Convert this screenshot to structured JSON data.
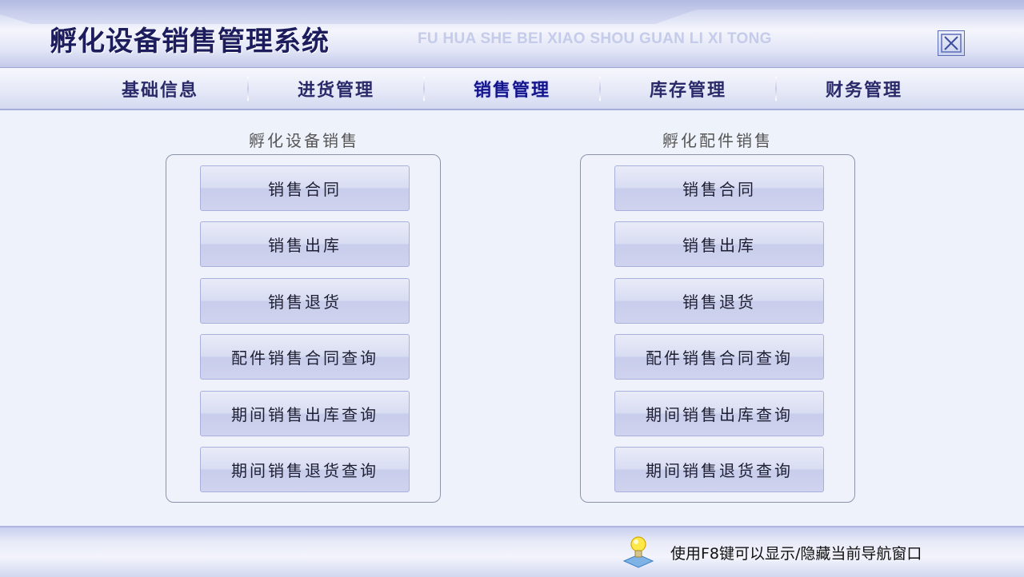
{
  "app": {
    "title": "孵化设备销售管理系统",
    "subtitle": "FU HUA SHE BEI XIAO SHOU GUAN LI XI TONG"
  },
  "nav": {
    "items": [
      {
        "label": "基础信息",
        "active": false
      },
      {
        "label": "进货管理",
        "active": false
      },
      {
        "label": "销售管理",
        "active": true
      },
      {
        "label": "库存管理",
        "active": false
      },
      {
        "label": "财务管理",
        "active": false
      }
    ]
  },
  "panels": [
    {
      "title": "孵化设备销售",
      "buttons": [
        "销售合同",
        "销售出库",
        "销售退货",
        "配件销售合同查询",
        "期间销售出库查询",
        "期间销售退货查询"
      ]
    },
    {
      "title": "孵化配件销售",
      "buttons": [
        "销售合同",
        "销售出库",
        "销售退货",
        "配件销售合同查询",
        "期间销售出库查询",
        "期间销售退货查询"
      ]
    }
  ],
  "footer": {
    "hint": "使用F8键可以显示/隐藏当前导航窗口",
    "icon": "lightbulb-icon"
  },
  "colors": {
    "title_text": "#1d1d5e",
    "nav_active": "#14148a",
    "button_border": "#aab0dc",
    "panel_border": "#8e93ad"
  }
}
